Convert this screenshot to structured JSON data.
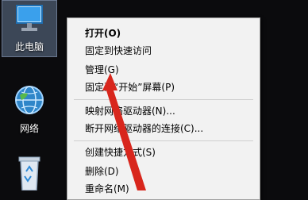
{
  "desktop": {
    "icons": [
      {
        "label": "此电脑"
      },
      {
        "label": "网络"
      },
      {
        "label": ""
      }
    ]
  },
  "context_menu": {
    "items": [
      {
        "label": "打开(O)"
      },
      {
        "label": "固定到快速访问"
      },
      {
        "label": "管理(G)"
      },
      {
        "label": "固定到“开始”屏幕(P)"
      },
      {
        "label": "映射网络驱动器(N)..."
      },
      {
        "label": "断开网络驱动器的连接(C)..."
      },
      {
        "label": "创建快捷方式(S)"
      },
      {
        "label": "删除(D)"
      },
      {
        "label": "重命名(M)"
      }
    ]
  },
  "colors": {
    "desktop_bg": "#0b0b0d",
    "menu_bg": "#f2f2f2",
    "arrow": "#d8261c",
    "selected_icon_bg": "#3c4757"
  }
}
